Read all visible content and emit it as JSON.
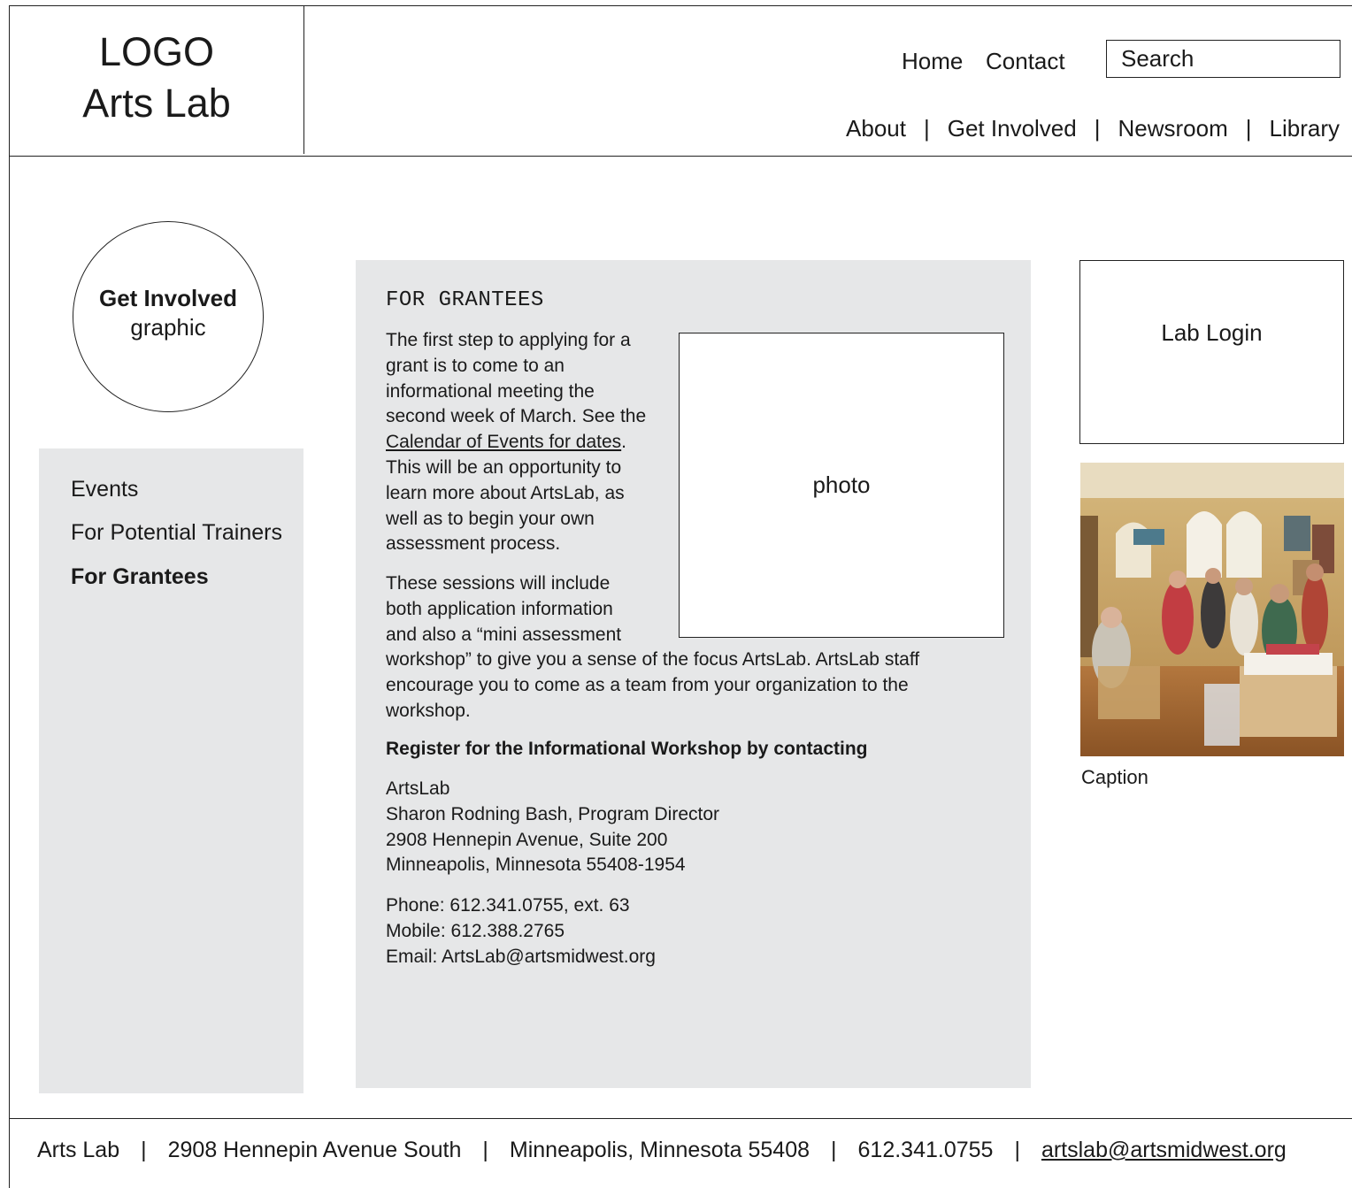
{
  "logo": {
    "line1": "LOGO",
    "line2": "Arts Lab"
  },
  "utility_nav": {
    "home": "Home",
    "contact": "Contact",
    "search_placeholder": "Search"
  },
  "main_nav": {
    "items": [
      "About",
      "Get Involved",
      "Newsroom",
      "Library"
    ],
    "separator": "|"
  },
  "graphic": {
    "title": "Get Involved",
    "subtitle": "graphic"
  },
  "sidebar": {
    "items": [
      {
        "label": "Events",
        "active": false
      },
      {
        "label": "For Potential Trainers",
        "active": false
      },
      {
        "label": "For Grantees",
        "active": true
      }
    ]
  },
  "content": {
    "title": "FOR GRANTEES",
    "photo_placeholder": "photo",
    "para1_lines": [
      "The first step to applying for a",
      "grant is to come to an",
      "informational meeting the",
      "second week of March. See the"
    ],
    "para1_link": "Calendar of Events for dates",
    "para1_link_suffix": ".",
    "para1_after_lines": [
      "This will be an opportunity to",
      "learn more about ArtsLab, as",
      "well as to begin your own",
      "assessment process."
    ],
    "para2_lines": [
      "These sessions will include",
      "both application information",
      "and also a “mini assessment",
      "workshop” to give you a sense of the focus ArtsLab.  ArtsLab staff",
      "encourage you to come as a team from your organization to the",
      "workshop."
    ],
    "register_heading": "Register for the Informational Workshop by contacting",
    "address_lines": [
      "ArtsLab",
      "Sharon Rodning Bash, Program Director",
      "2908 Hennepin Avenue, Suite 200",
      "Minneapolis, Minnesota 55408-1954"
    ],
    "contact_lines": [
      "Phone:  612.341.0755, ext. 63",
      "Mobile:  612.388.2765",
      "Email:  ArtsLab@artsmidwest.org"
    ]
  },
  "right": {
    "login_label": "Lab Login",
    "caption": "Caption"
  },
  "footer": {
    "name": "Arts Lab",
    "address": "2908 Hennepin Avenue South",
    "city": "Minneapolis, Minnesota  55408",
    "phone": "612.341.0755",
    "email": "artslab@artsmidwest.org",
    "separator": "|"
  }
}
